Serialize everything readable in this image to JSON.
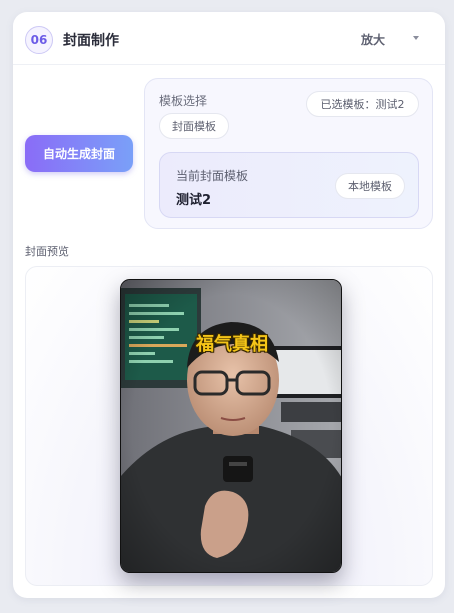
{
  "header": {
    "step": "06",
    "title": "封面制作",
    "zoom_label": "放大"
  },
  "actions": {
    "auto_generate": "自动生成封面"
  },
  "template": {
    "section_label": "模板选择",
    "selected_pill": "已选模板：测试2",
    "chip": "封面模板",
    "current_label": "当前封面模板",
    "current_value": "测试2",
    "local_button": "本地模板"
  },
  "preview": {
    "label": "封面预览",
    "cover_text": "福气真相"
  },
  "colors": {
    "accent": "#6c5ce7",
    "button_gradient_start": "#8a6cf7",
    "button_gradient_end": "#7aa0f8",
    "cover_text": "#f5c518"
  }
}
